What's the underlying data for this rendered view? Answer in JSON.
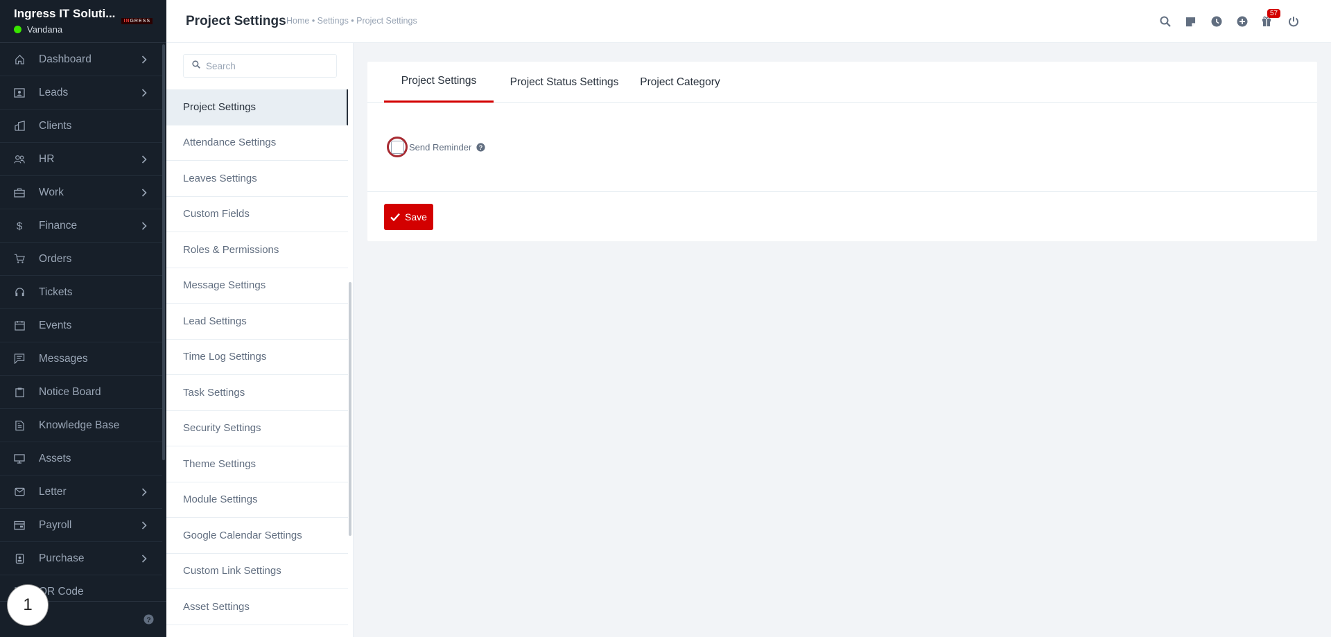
{
  "brand": {
    "name": "Ingress IT Soluti...",
    "user": "Vandana",
    "logo_text": "IN",
    "logo_text_rest": "GRESS"
  },
  "colors": {
    "sidebar_bg": "#171f29",
    "accent": "#d30000",
    "online": "#39e500"
  },
  "sidebar": {
    "items": [
      {
        "label": "Dashboard",
        "icon": "house-icon",
        "has_children": true
      },
      {
        "label": "Leads",
        "icon": "id-card-icon",
        "has_children": true
      },
      {
        "label": "Clients",
        "icon": "building-icon",
        "has_children": false
      },
      {
        "label": "HR",
        "icon": "people-icon",
        "has_children": true
      },
      {
        "label": "Work",
        "icon": "briefcase-icon",
        "has_children": true
      },
      {
        "label": "Finance",
        "icon": "dollar-icon",
        "has_children": true
      },
      {
        "label": "Orders",
        "icon": "cart-icon",
        "has_children": false
      },
      {
        "label": "Tickets",
        "icon": "headset-icon",
        "has_children": false
      },
      {
        "label": "Events",
        "icon": "calendar-icon",
        "has_children": false
      },
      {
        "label": "Messages",
        "icon": "chat-icon",
        "has_children": false
      },
      {
        "label": "Notice Board",
        "icon": "clipboard-icon",
        "has_children": false
      },
      {
        "label": "Knowledge Base",
        "icon": "document-icon",
        "has_children": false
      },
      {
        "label": "Assets",
        "icon": "monitor-icon",
        "has_children": false
      },
      {
        "label": "Letter",
        "icon": "envelope-icon",
        "has_children": true
      },
      {
        "label": "Payroll",
        "icon": "wallet-icon",
        "has_children": true
      },
      {
        "label": "Purchase",
        "icon": "purchase-icon",
        "has_children": true
      },
      {
        "label": "QR Code",
        "icon": "qr-icon",
        "has_children": false
      }
    ]
  },
  "step_badge": "1",
  "header": {
    "title": "Project Settings",
    "breadcrumb": "Home • Settings • Project Settings",
    "notification_count": "57"
  },
  "settings_menu": {
    "search_placeholder": "Search",
    "items": [
      "Project Settings",
      "Attendance Settings",
      "Leaves Settings",
      "Custom Fields",
      "Roles & Permissions",
      "Message Settings",
      "Lead Settings",
      "Time Log Settings",
      "Task Settings",
      "Security Settings",
      "Theme Settings",
      "Module Settings",
      "Google Calendar Settings",
      "Custom Link Settings",
      "Asset Settings"
    ],
    "active_index": 0
  },
  "main": {
    "tabs": [
      {
        "label": "Project Settings",
        "active": true
      },
      {
        "label": "Project Status Settings",
        "active": false
      },
      {
        "label": "Project Category",
        "active": false
      }
    ],
    "send_reminder": {
      "label": "Send Reminder",
      "checked": false
    },
    "save_label": "Save"
  }
}
